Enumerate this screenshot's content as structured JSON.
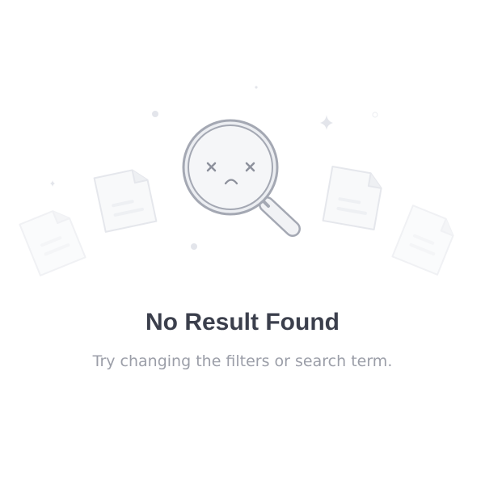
{
  "empty_state": {
    "title": "No Result Found",
    "message": "Try changing the filters or search term.",
    "illustration_icon": "sad-magnifying-glass-icon",
    "decor_icons": [
      "document-icon",
      "sparkle-icon",
      "dot-icon"
    ]
  },
  "colors": {
    "title": "#3b3f4c",
    "message": "#9b9ea8",
    "illustration_stroke": "#a4a8b3",
    "illustration_fill": "#f4f5f8",
    "decor": "#e3e5eb"
  }
}
